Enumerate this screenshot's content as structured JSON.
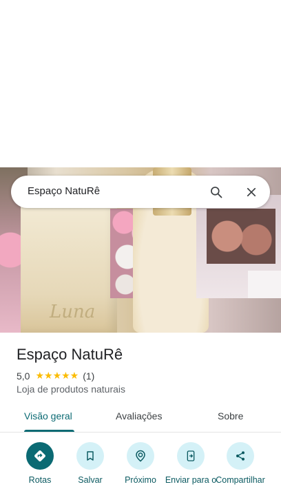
{
  "search": {
    "query": "Espaço NatuRê"
  },
  "place": {
    "name": "Espaço NatuRê",
    "rating": "5,0",
    "stars": "★★★★★",
    "review_count": "(1)",
    "category": "Loja de produtos naturais"
  },
  "tabs": [
    {
      "label": "Visão geral",
      "active": true
    },
    {
      "label": "Avaliações",
      "active": false
    },
    {
      "label": "Sobre",
      "active": false
    }
  ],
  "actions": [
    {
      "label": "Rotas",
      "icon": "directions-icon"
    },
    {
      "label": "Salvar",
      "icon": "bookmark-icon"
    },
    {
      "label": "Próximo",
      "icon": "nearby-icon"
    },
    {
      "label": "Enviar para o",
      "icon": "send-to-phone-icon"
    },
    {
      "label": "Compartilhar",
      "icon": "share-icon"
    }
  ],
  "colors": {
    "accent": "#0b6a73",
    "action_bg": "#d4f1f7",
    "stars": "#fbbc04"
  }
}
